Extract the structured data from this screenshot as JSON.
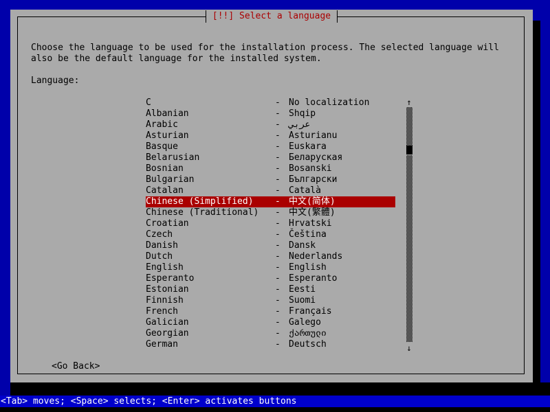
{
  "window": {
    "title": "[!!] Select a language",
    "title_color": "#aa0000",
    "background_color": "#0000aa",
    "panel_color": "#aaaaaa"
  },
  "description": {
    "line1": "Choose the language to be used for the installation process. The selected language will",
    "line2": "also be the default language for the installed system."
  },
  "field": {
    "label": "Language:"
  },
  "languages": [
    {
      "english": "C",
      "dash": "-",
      "native": "No localization",
      "selected": false
    },
    {
      "english": "Albanian",
      "dash": "-",
      "native": "Shqip",
      "selected": false
    },
    {
      "english": "Arabic",
      "dash": "-",
      "native": "عربي",
      "selected": false
    },
    {
      "english": "Asturian",
      "dash": "-",
      "native": "Asturianu",
      "selected": false
    },
    {
      "english": "Basque",
      "dash": "-",
      "native": "Euskara",
      "selected": false
    },
    {
      "english": "Belarusian",
      "dash": "-",
      "native": "Беларуская",
      "selected": false
    },
    {
      "english": "Bosnian",
      "dash": "-",
      "native": "Bosanski",
      "selected": false
    },
    {
      "english": "Bulgarian",
      "dash": "-",
      "native": "Български",
      "selected": false
    },
    {
      "english": "Catalan",
      "dash": "-",
      "native": "Català",
      "selected": false
    },
    {
      "english": "Chinese (Simplified)",
      "dash": "-",
      "native": "中文(简体)",
      "selected": true
    },
    {
      "english": "Chinese (Traditional)",
      "dash": "-",
      "native": "中文(繁體)",
      "selected": false
    },
    {
      "english": "Croatian",
      "dash": "-",
      "native": "Hrvatski",
      "selected": false
    },
    {
      "english": "Czech",
      "dash": "-",
      "native": "Čeština",
      "selected": false
    },
    {
      "english": "Danish",
      "dash": "-",
      "native": "Dansk",
      "selected": false
    },
    {
      "english": "Dutch",
      "dash": "-",
      "native": "Nederlands",
      "selected": false
    },
    {
      "english": "English",
      "dash": "-",
      "native": "English",
      "selected": false
    },
    {
      "english": "Esperanto",
      "dash": "-",
      "native": "Esperanto",
      "selected": false
    },
    {
      "english": "Estonian",
      "dash": "-",
      "native": "Eesti",
      "selected": false
    },
    {
      "english": "Finnish",
      "dash": "-",
      "native": "Suomi",
      "selected": false
    },
    {
      "english": "French",
      "dash": "-",
      "native": "Français",
      "selected": false
    },
    {
      "english": "Galician",
      "dash": "-",
      "native": "Galego",
      "selected": false
    },
    {
      "english": "Georgian",
      "dash": "-",
      "native": "ქართული",
      "selected": false
    },
    {
      "english": "German",
      "dash": "-",
      "native": "Deutsch",
      "selected": false
    }
  ],
  "selection": {
    "selected_language": "Chinese (Simplified)",
    "highlight_background": "#aa0000",
    "highlight_foreground": "#ffffff"
  },
  "scrollbar": {
    "up_arrow": "↑",
    "down_arrow": "↓"
  },
  "buttons": {
    "go_back": "<Go Back>"
  },
  "help_bar": {
    "text": "<Tab> moves; <Space> selects; <Enter> activates buttons",
    "background_color": "#0000cc",
    "foreground_color": "#ffffff"
  }
}
